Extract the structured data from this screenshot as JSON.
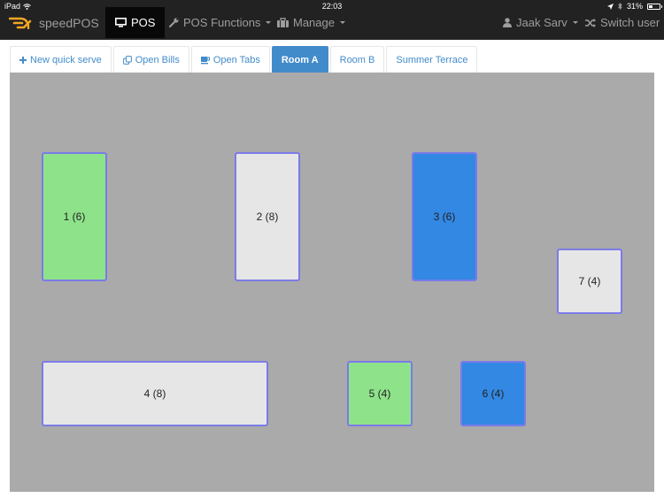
{
  "status_bar": {
    "device": "iPad",
    "time": "22:03",
    "battery_percent_label": "31%",
    "battery_level": 0.31
  },
  "navbar": {
    "brand": "speedPOS",
    "items": [
      {
        "label": "POS",
        "icon": "desktop-icon",
        "active": true,
        "dropdown": false
      },
      {
        "label": "POS Functions",
        "icon": "wrench-icon",
        "active": false,
        "dropdown": true
      },
      {
        "label": "Manage",
        "icon": "briefcase-icon",
        "active": false,
        "dropdown": true
      }
    ],
    "user": {
      "label": "Jaak Sarv",
      "icon": "user-icon",
      "dropdown": true
    },
    "switch_user": {
      "label": "Switch user",
      "icon": "shuffle-icon"
    }
  },
  "tabs": [
    {
      "label": "New quick serve",
      "icon": "plus-icon",
      "active": false
    },
    {
      "label": "Open Bills",
      "icon": "copy-icon",
      "active": false
    },
    {
      "label": "Open Tabs",
      "icon": "coffee-icon",
      "active": false
    },
    {
      "label": "Room A",
      "icon": null,
      "active": true
    },
    {
      "label": "Room B",
      "icon": null,
      "active": false
    },
    {
      "label": "Summer Terrace",
      "icon": null,
      "active": false
    }
  ],
  "colors": {
    "status_free": "#e6e6e6",
    "status_green": "#8ee28a",
    "status_blue": "#3388e3",
    "table_border": "#7b7be8",
    "floor": "#aaaaaa",
    "accent": "#428bca",
    "logo": "#f5a623"
  },
  "room": {
    "name": "Room A",
    "tables": [
      {
        "label": "1 (6)",
        "number": 1,
        "seats": 6,
        "status": "green"
      },
      {
        "label": "2 (8)",
        "number": 2,
        "seats": 8,
        "status": "free"
      },
      {
        "label": "3 (6)",
        "number": 3,
        "seats": 6,
        "status": "blue"
      },
      {
        "label": "7 (4)",
        "number": 7,
        "seats": 4,
        "status": "free"
      },
      {
        "label": "4 (8)",
        "number": 4,
        "seats": 8,
        "status": "free"
      },
      {
        "label": "5 (4)",
        "number": 5,
        "seats": 4,
        "status": "green"
      },
      {
        "label": "6 (4)",
        "number": 6,
        "seats": 4,
        "status": "blue"
      }
    ]
  }
}
